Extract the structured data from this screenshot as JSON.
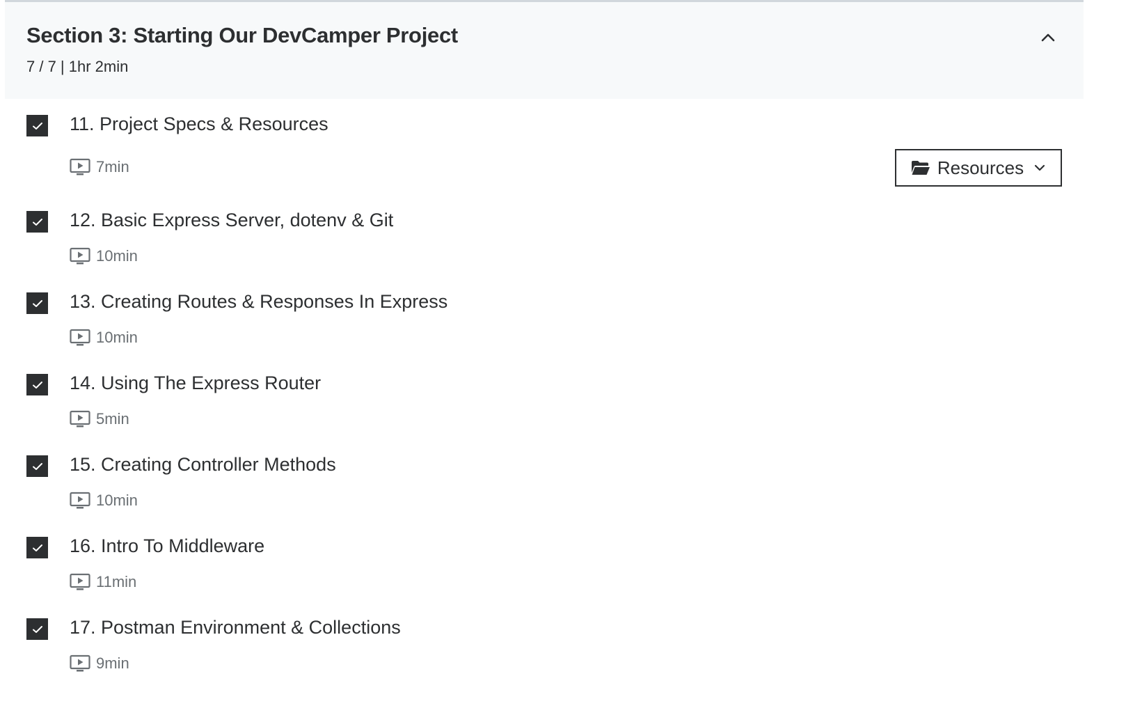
{
  "section": {
    "title": "Section 3: Starting Our DevCamper Project",
    "meta": "7 / 7 | 1hr 2min",
    "collapse_icon": "chevron-up-icon"
  },
  "resources_button": {
    "label": "Resources",
    "icon": "folder-open-icon",
    "dropdown_icon": "chevron-down-icon"
  },
  "lectures": [
    {
      "title": "11. Project Specs & Resources",
      "duration": "7min",
      "completed": true
    },
    {
      "title": "12. Basic Express Server, dotenv & Git",
      "duration": "10min",
      "completed": true
    },
    {
      "title": "13. Creating Routes & Responses In Express",
      "duration": "10min",
      "completed": true
    },
    {
      "title": "14. Using The Express Router",
      "duration": "5min",
      "completed": true
    },
    {
      "title": "15. Creating Controller Methods",
      "duration": "10min",
      "completed": true
    },
    {
      "title": "16. Intro To Middleware",
      "duration": "11min",
      "completed": true
    },
    {
      "title": "17. Postman Environment & Collections",
      "duration": "9min",
      "completed": true
    }
  ],
  "colors": {
    "text": "#2d2f31",
    "muted": "#6a6f73",
    "header_bg": "#f7f9fa",
    "checkbox": "#2d2f31"
  }
}
